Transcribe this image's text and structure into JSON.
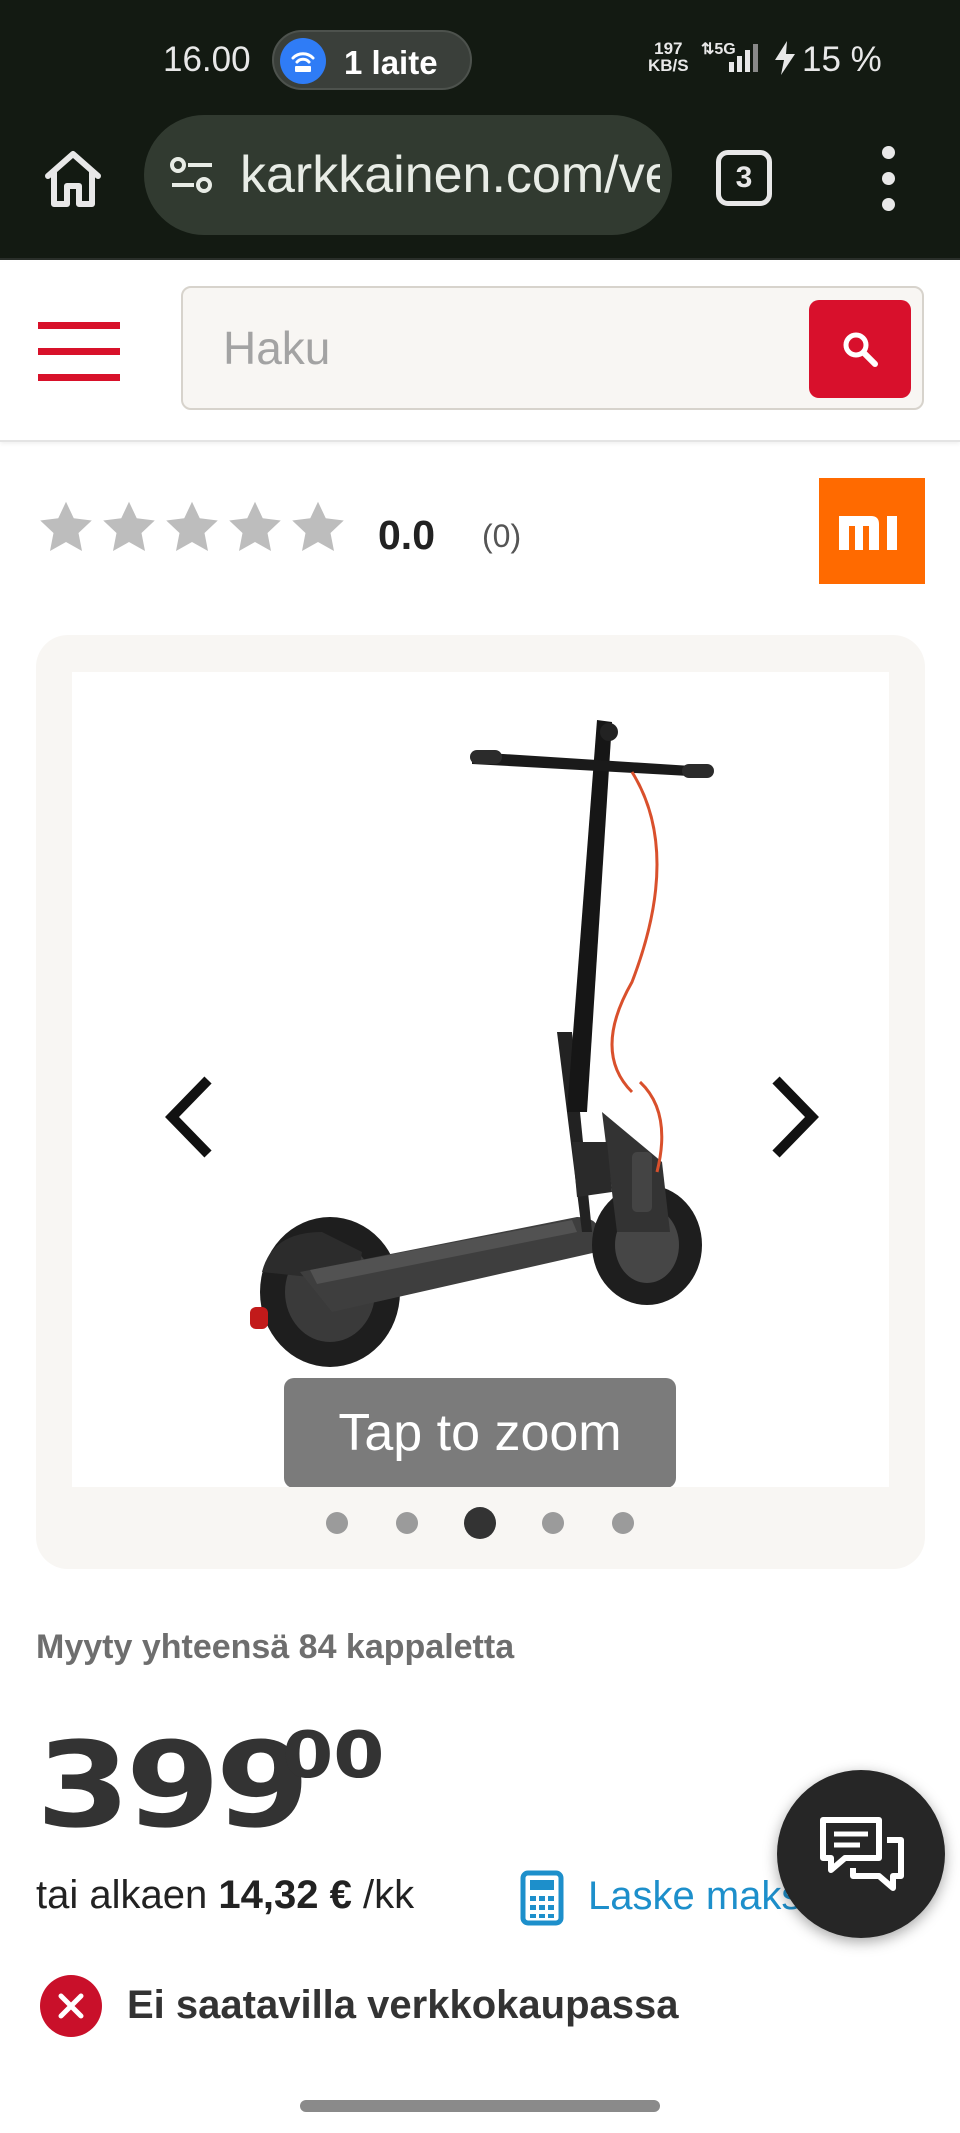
{
  "status_bar": {
    "time": "16.00",
    "hotspot_label": "1 laite",
    "net_speed_value": "197",
    "net_speed_unit": "KB/S",
    "network_type": "5G",
    "battery": "15 %"
  },
  "browser": {
    "url": "karkkainen.com/verkkokauppa",
    "tab_count": "3"
  },
  "header": {
    "search_placeholder": "Haku"
  },
  "product": {
    "rating_value": "0.0",
    "rating_count": "(0)",
    "stars_filled": 0,
    "stars_total": 5,
    "brand": "MI",
    "brand_color": "#ff6a00",
    "image_zoom_hint": "Tap to zoom",
    "gallery_total_images": 5,
    "gallery_active_index": 2,
    "sold_count": "Myyty yhteensä 84 kappaletta",
    "price_whole": "399",
    "price_cents": "00",
    "installment_prefix": "tai alkaen",
    "installment_amount": "14,32 €",
    "installment_suffix": "/kk",
    "calculator_label": "Laske maksuerä",
    "availability": "Ei saatavilla verkkokaupassa"
  },
  "colors": {
    "accent_red": "#d8102c",
    "link_blue": "#1d8fcb",
    "chrome_dark": "#131a12"
  },
  "icons": {
    "home": "home-icon",
    "site_settings": "tune-icon",
    "menu": "more-vert-icon",
    "hamburger": "hamburger-icon",
    "search": "search-icon",
    "star": "star-icon",
    "prev": "chevron-left-icon",
    "next": "chevron-right-icon",
    "calculator": "calculator-icon",
    "chat": "chat-icon",
    "unavailable": "close-circle-icon"
  }
}
